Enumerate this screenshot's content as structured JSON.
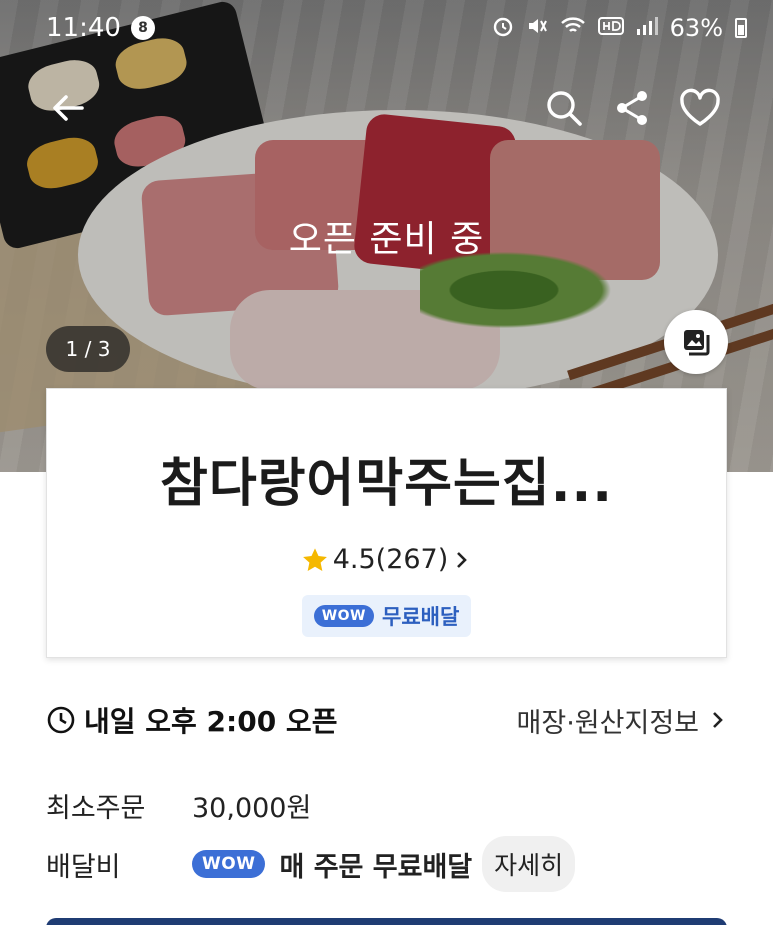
{
  "status_bar": {
    "time": "11:40",
    "notification_count": "8",
    "battery": "63%"
  },
  "hero": {
    "overlay_text": "오픈 준비 중",
    "page_counter": "1 / 3"
  },
  "store": {
    "name": "참다랑어막주는집...",
    "rating": "4.5(267)",
    "wow_badge": "WOW",
    "free_delivery": "무료배달"
  },
  "info": {
    "open_time": "내일 오후 2:00 오픈",
    "store_info_link": "매장·원산지정보",
    "min_order_label": "최소주문",
    "min_order_value": "30,000원",
    "delivery_fee_label": "배달비",
    "delivery_wow": "WOW",
    "delivery_text": "매 주문 무료배달",
    "details_button": "자세히"
  },
  "colors": {
    "brand_blue": "#3c6fd6",
    "star": "#f5b800",
    "bottom_bar": "#1f3c73"
  }
}
